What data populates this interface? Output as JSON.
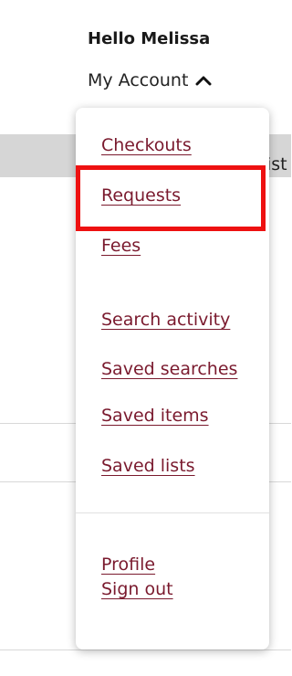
{
  "header": {
    "greeting": "Hello Melissa",
    "account_label": "My Account",
    "account_icon": "chevron-up-icon"
  },
  "background": {
    "band_text": "ist"
  },
  "menu": {
    "account_items": [
      {
        "label": "Checkouts"
      },
      {
        "label": "Requests"
      },
      {
        "label": "Fees"
      }
    ],
    "search_items": [
      {
        "label": "Search activity"
      },
      {
        "label": "Saved searches"
      },
      {
        "label": "Saved items"
      },
      {
        "label": "Saved lists"
      }
    ],
    "profile_items": [
      {
        "label": "Profile"
      },
      {
        "label": "Sign out"
      }
    ]
  },
  "colors": {
    "link": "#7a1a2e",
    "highlight": "#ee1111"
  }
}
